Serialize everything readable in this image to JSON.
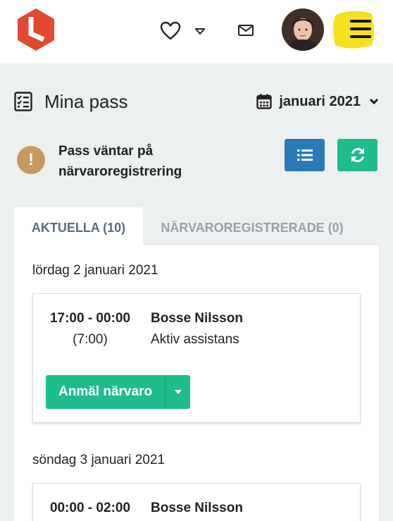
{
  "header": {
    "icons": {
      "logo": "logo-icon",
      "favorites": "heart-icon",
      "dropdown": "caret-down-icon",
      "messages": "mail-icon",
      "menu": "hamburger-icon"
    },
    "menu_highlight_color": "#f5e21c"
  },
  "page": {
    "title": "Mina pass",
    "month_label": "januari 2021"
  },
  "alert": {
    "symbol": "!",
    "text": "Pass väntar på närvaroregistrering"
  },
  "tabs": [
    {
      "label": "AKTUELLA (10)",
      "active": true
    },
    {
      "label": "NÄRVAROREGISTRERADE (0)",
      "active": false
    }
  ],
  "shifts": [
    {
      "date": "lördag 2 januari 2021",
      "time": "17:00 - 00:00",
      "duration": "(7:00)",
      "person": "Bosse Nilsson",
      "service": "Aktiv assistans",
      "action_label": "Anmäl närvaro"
    },
    {
      "date": "söndag 3 januari 2021",
      "time": "00:00 - 02:00",
      "person": "Bosse Nilsson"
    }
  ],
  "colors": {
    "brand": "#e2492f",
    "primary_blue": "#2a7ab8",
    "success_green": "#1fbc8c",
    "warning": "#c59a5e",
    "background": "#ecf0f1"
  }
}
